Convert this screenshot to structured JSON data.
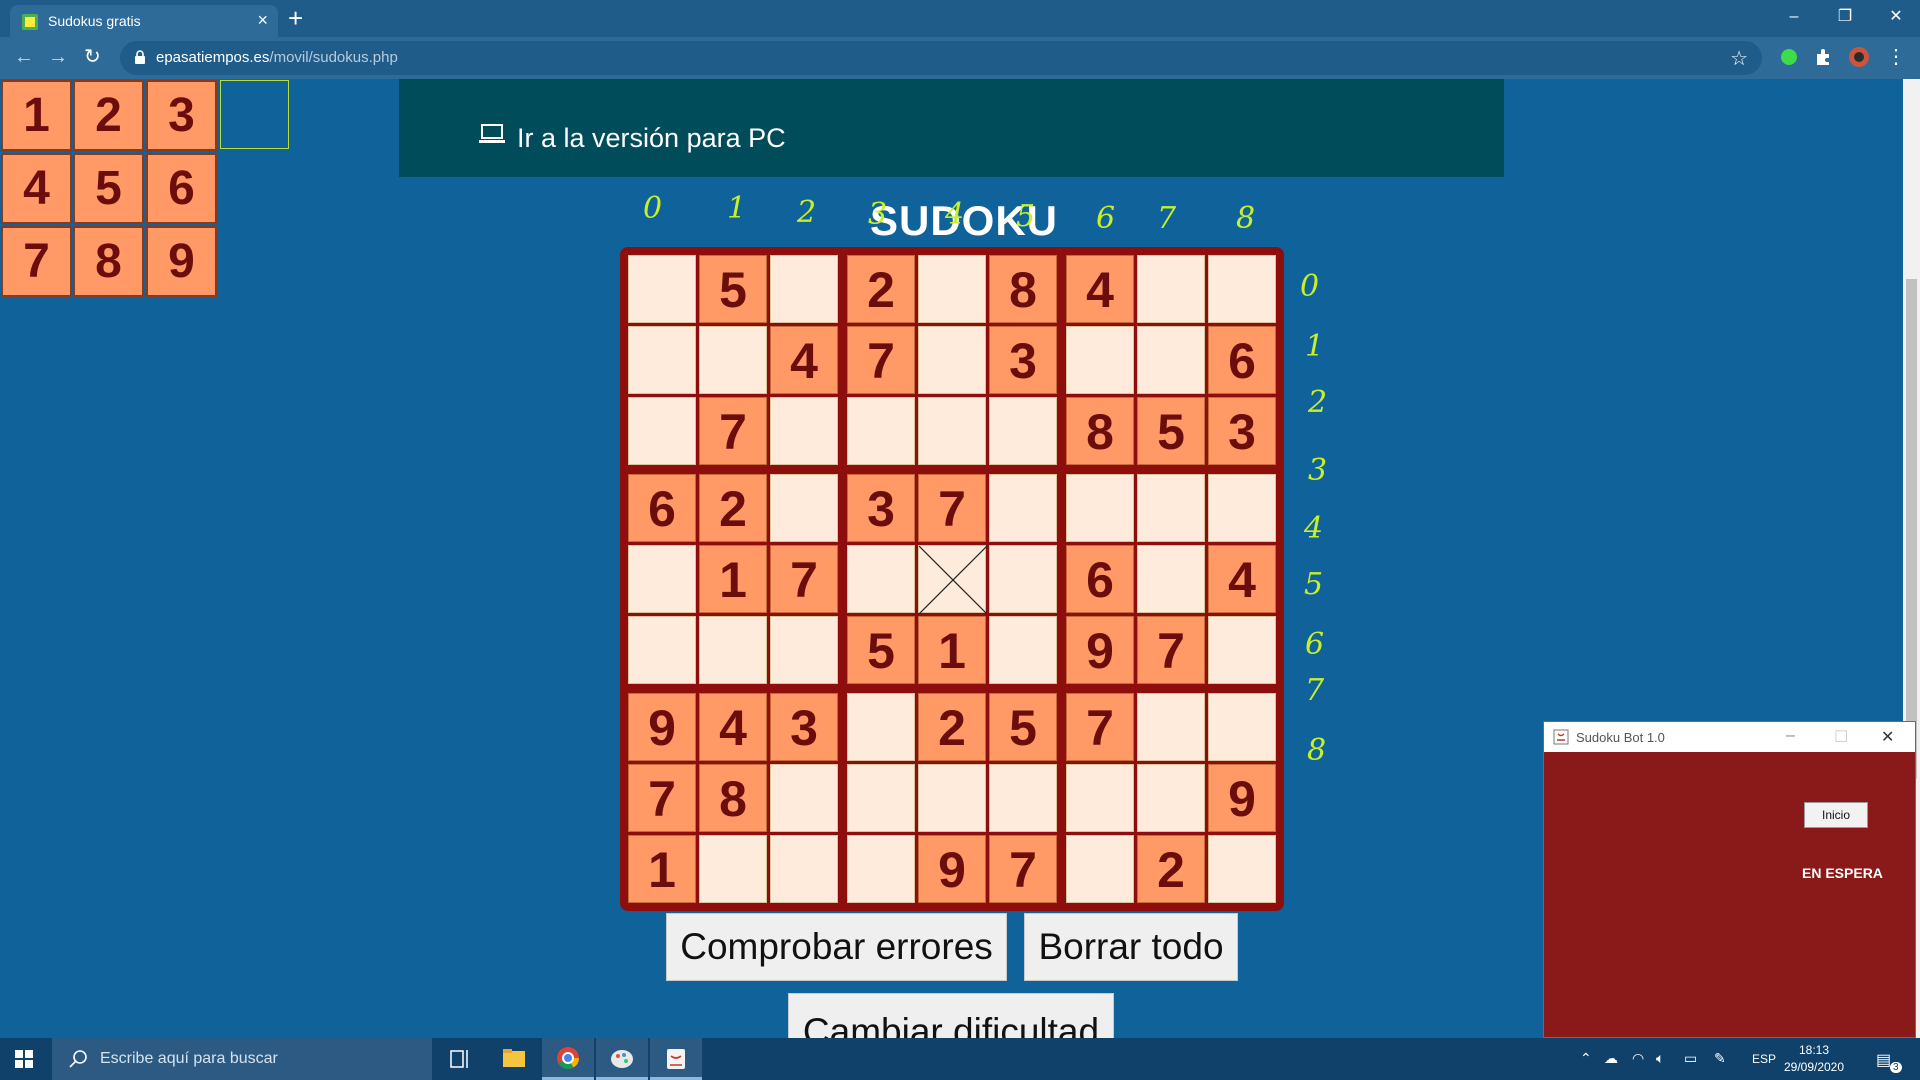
{
  "browser": {
    "tab_title": "Sudokus gratis",
    "url_host": "epasatiempos.es",
    "url_path": "/movil/sudokus.php"
  },
  "page": {
    "numpad": [
      "1",
      "2",
      "3",
      "4",
      "5",
      "6",
      "7",
      "8",
      "9"
    ],
    "pc_link": "Ir a la versión para PC",
    "title": "SUDOKU",
    "col_labels": [
      "0",
      "1",
      "2",
      "3",
      "4",
      "5",
      "6",
      "7",
      "8"
    ],
    "row_labels": [
      "0",
      "1",
      "2",
      "3",
      "4",
      "5",
      "6",
      "7",
      "8"
    ],
    "grid": [
      [
        "",
        "5",
        "",
        "2",
        "",
        "8",
        "4",
        "",
        ""
      ],
      [
        "",
        "",
        "4",
        "7",
        "",
        "3",
        "",
        "",
        "6"
      ],
      [
        "",
        "7",
        "",
        "",
        "",
        "",
        "8",
        "5",
        "3"
      ],
      [
        "6",
        "2",
        "",
        "3",
        "7",
        "",
        "",
        "",
        ""
      ],
      [
        "",
        "1",
        "7",
        "",
        "",
        "",
        "6",
        "",
        "4"
      ],
      [
        "",
        "",
        "",
        "5",
        "1",
        "",
        "9",
        "7",
        ""
      ],
      [
        "9",
        "4",
        "3",
        "",
        "2",
        "5",
        "7",
        "",
        ""
      ],
      [
        "7",
        "8",
        "",
        "",
        "",
        "",
        "",
        "",
        "9"
      ],
      [
        "1",
        "",
        "",
        "",
        "9",
        "7",
        "",
        "2",
        ""
      ]
    ],
    "buttons": {
      "check": "Comprobar errores",
      "clear": "Borrar todo",
      "difficulty": "Cambiar dificultad"
    }
  },
  "bot_window": {
    "title": "Sudoku Bot 1.0",
    "start_label": "Inicio",
    "status": "EN ESPERA"
  },
  "taskbar": {
    "search_placeholder": "Escribe aquí para buscar",
    "language": "ESP",
    "time": "18:13",
    "date": "29/09/2020",
    "notification_count": "3"
  },
  "colors": {
    "page_bg": "#0f629a",
    "given_cell": "#ff9a66",
    "empty_cell": "#ffebdb",
    "board_border": "#8e0e0e",
    "digit": "#6b0d0d",
    "annotation": "#c7ef2a",
    "bot_bg": "#8a1a1a"
  }
}
